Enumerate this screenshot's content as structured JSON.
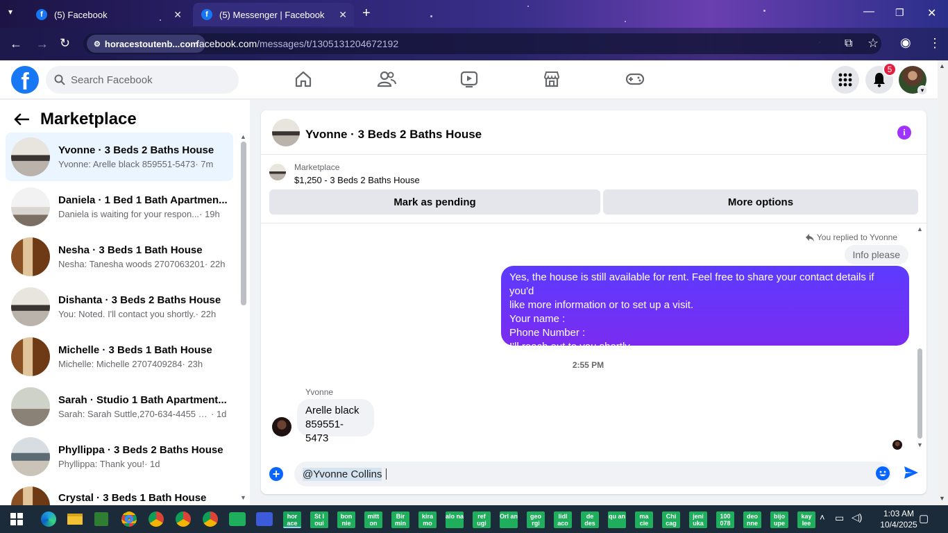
{
  "browser": {
    "tabs": [
      {
        "title": "(5) Facebook"
      },
      {
        "title": "(5) Messenger | Facebook"
      }
    ],
    "site_chip": "horacestoutenb...com",
    "url_domain": "facebook.com",
    "url_path": "/messages/t/1305131204672192"
  },
  "fbnav": {
    "search_placeholder": "Search Facebook",
    "notification_count": "5"
  },
  "left": {
    "title": "Marketplace",
    "conversations": [
      {
        "name": "Yvonne · 3 Beds 2 Baths House",
        "preview": "Yvonne: Arelle black 859551-5473",
        "time": " · 7m",
        "active": true
      },
      {
        "name": "Daniela · 1 Bed 1 Bath Apartmen...",
        "preview": "Daniela is waiting for your respon...",
        "time": " · 19h"
      },
      {
        "name": "Nesha · 3 Beds 1 Bath House",
        "preview": "Nesha: Tanesha woods 2707063201",
        "time": " · 22h"
      },
      {
        "name": "Dishanta · 3 Beds 2 Baths House",
        "preview": "You: Noted. I'll contact you shortly.",
        "time": " · 22h"
      },
      {
        "name": "Michelle · 3 Beds 1 Bath House",
        "preview": "Michelle: Michelle 2707409284",
        "time": " · 23h"
      },
      {
        "name": "Sarah · Studio 1 Bath Apartment...",
        "preview": "Sarah: Sarah Suttle,270-634-4455 w...",
        "time": " · 1d"
      },
      {
        "name": "Phyllippa · 3 Beds 2 Baths House",
        "preview": "Phyllippa: Thank you!",
        "time": " · 1d"
      },
      {
        "name": "Crystal · 3 Beds 1 Bath House",
        "preview": "",
        "time": ""
      }
    ]
  },
  "chat": {
    "title": "Yvonne · 3 Beds 2 Baths House",
    "marketplace_label": "Marketplace",
    "listing": "$1,250 - 3 Beds 2 Baths House",
    "mark_pending": "Mark as pending",
    "more_options": "More options",
    "replied_to": "You replied to Yvonne",
    "quoted": "Info please",
    "my_message_lines": [
      "Yes, the house is still available for rent. Feel free to share your contact details if you'd",
      "like more information or to set up a visit.",
      "Your name :",
      "Phone Number :",
      "I'll reach out to you shortly."
    ],
    "timestamp": "2:55 PM",
    "sender": "Yvonne",
    "their_message_lines": [
      "Arelle black",
      "859551-5473"
    ],
    "composer_text": "@Yvonne Collins"
  },
  "taskbar": {
    "tiles": [
      "hor ace",
      "St l oui",
      "bon nie",
      "mitt on",
      "Bir min",
      "kira mo",
      "alo na",
      "ref ugi",
      "Orl an",
      "geo rgi",
      "lidl aco",
      "de des",
      "qu an",
      "ma cie",
      "Chi cag",
      "jeni uka",
      "100 078",
      "deo nne",
      "bijo upe",
      "kay lee"
    ],
    "time": "1:03 AM",
    "date": "10/4/2025"
  },
  "colors": {
    "facebook_blue": "#1877f2",
    "my_bubble": "#6a33f5",
    "info_icon": "#a033ff",
    "notif_badge": "#e41e3f"
  }
}
